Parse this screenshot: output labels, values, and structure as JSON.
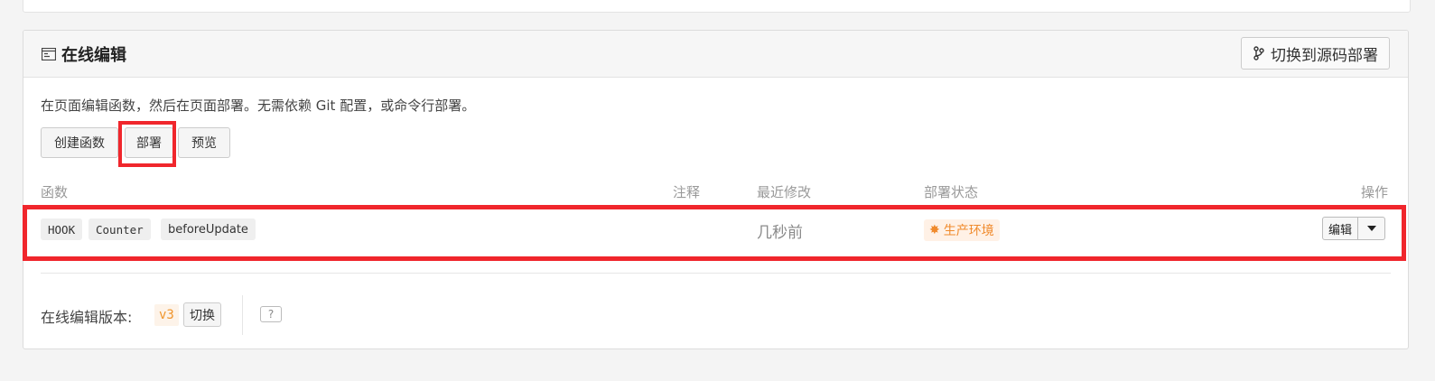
{
  "panel": {
    "title": "在线编辑",
    "title_icon": "code-editor-icon",
    "switch_source_label": "切换到源码部署",
    "switch_source_icon": "branch-icon",
    "description": "在页面编辑函数，然后在页面部署。无需依赖 Git 配置，或命令行部署。"
  },
  "toolbar": {
    "create_label": "创建函数",
    "deploy_label": "部署",
    "preview_label": "预览"
  },
  "table": {
    "columns": {
      "function": "函数",
      "comment": "注释",
      "modified": "最近修改",
      "status": "部署状态",
      "actions": "操作"
    },
    "rows": [
      {
        "tags": [
          "HOOK",
          "Counter",
          "beforeUpdate"
        ],
        "comment": "",
        "modified": "几秒前",
        "status": "生产环境",
        "status_color": "#f08a2c",
        "edit_label": "编辑"
      }
    ]
  },
  "footer": {
    "version_label": "在线编辑版本:",
    "version_value": "v3",
    "switch_label": "切换",
    "help_label": "?"
  },
  "colors": {
    "highlight": "#f0262c",
    "accent_orange": "#f08a2c"
  }
}
